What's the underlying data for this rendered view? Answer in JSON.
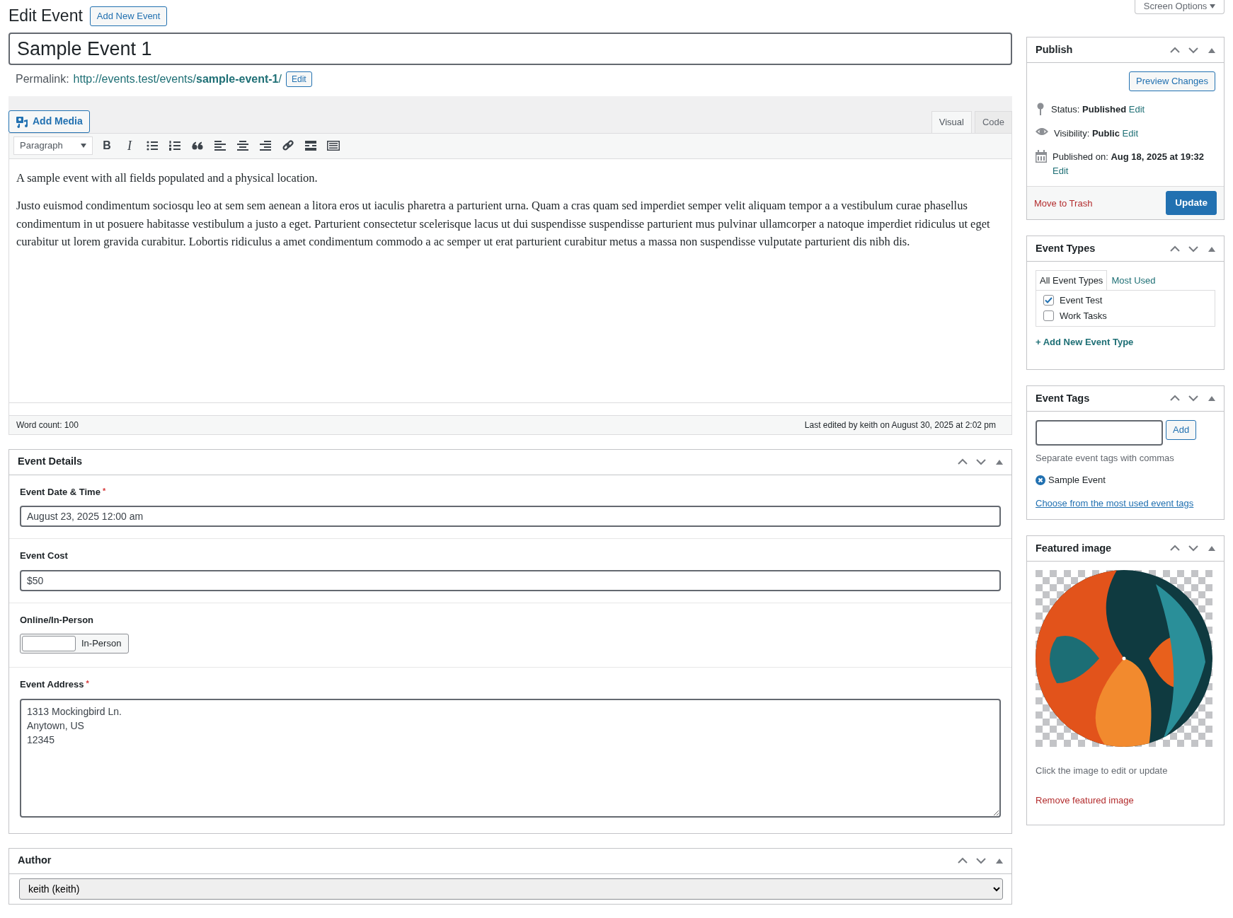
{
  "page": {
    "title": "Edit Event",
    "add_new": "Add New Event",
    "screen_options": "Screen Options"
  },
  "post_title": "Sample Event 1",
  "permalink": {
    "label": "Permalink:",
    "base": "http://events.test/events/",
    "slug": "sample-event-1",
    "trail": "/",
    "edit": "Edit"
  },
  "editor": {
    "add_media": "Add Media",
    "tabs": [
      {
        "label": "Visual",
        "selected": true
      },
      {
        "label": "Code",
        "selected": false
      }
    ],
    "format": "Paragraph",
    "bold_glyph": "B",
    "italic_glyph": "I",
    "paragraphs": [
      "A sample event with all fields populated and a physical location.",
      "Justo euismod condimentum sociosqu leo at sem sem aenean a litora eros ut iaculis pharetra a parturient urna. Quam a cras quam sed imperdiet semper velit aliquam tempor a a vestibulum curae phasellus condimentum in ut posuere habitasse vestibulum a justo a eget. Parturient consectetur scelerisque lacus ut dui suspendisse suspendisse parturient mus pulvinar ullamcorper a natoque imperdiet ridiculus ut eget curabitur ut lorem gravida curabitur. Lobortis ridiculus a amet condimentum commodo a ac semper ut erat parturient curabitur metus a massa non suspendisse vulputate parturient dis nibh dis."
    ],
    "word_count": "Word count: 100",
    "last_edited": "Last edited by keith on August 30, 2025 at 2:02 pm"
  },
  "event_details": {
    "title": "Event Details",
    "fields": [
      {
        "kind": "text",
        "label": "Event Date & Time",
        "required_mark": "*",
        "value": "August 23, 2025 12:00 am"
      },
      {
        "kind": "text",
        "label": "Event Cost",
        "value": "$50"
      },
      {
        "kind": "toggle",
        "label": "Online/In-Person",
        "on": false,
        "option": "In-Person"
      },
      {
        "kind": "textarea",
        "label": "Event Address",
        "required_mark": "*",
        "value": "1313 Mockingbird Ln.\nAnytown, US\n12345"
      }
    ]
  },
  "author": {
    "title": "Author",
    "value": "keith (keith)"
  },
  "publish": {
    "title": "Publish",
    "preview": "Preview Changes",
    "rows": [
      {
        "kind": "status",
        "label": "Status:",
        "value": "Published",
        "edit": "Edit"
      },
      {
        "kind": "visibility",
        "label": "Visibility:",
        "value": "Public",
        "edit": "Edit"
      },
      {
        "kind": "date",
        "label": "Published on:",
        "value": "Aug 18, 2025 at 19:32",
        "edit": "Edit"
      }
    ],
    "trash": "Move to Trash",
    "update": "Update"
  },
  "event_types": {
    "title": "Event Types",
    "tabs": [
      {
        "label": "All Event Types",
        "selected": true
      },
      {
        "label": "Most Used",
        "selected": false
      }
    ],
    "items": [
      {
        "label": "Event Test",
        "checked": true
      },
      {
        "label": "Work Tasks",
        "checked": false
      }
    ],
    "add_new": "+ Add New Event Type"
  },
  "event_tags": {
    "title": "Event Tags",
    "add": "Add",
    "hint": "Separate event tags with commas",
    "tags": [
      "Sample Event"
    ],
    "choose": "Choose from the most used event tags"
  },
  "featured_image": {
    "title": "Featured image",
    "hint": "Click the image to edit or update",
    "remove": "Remove featured image"
  }
}
